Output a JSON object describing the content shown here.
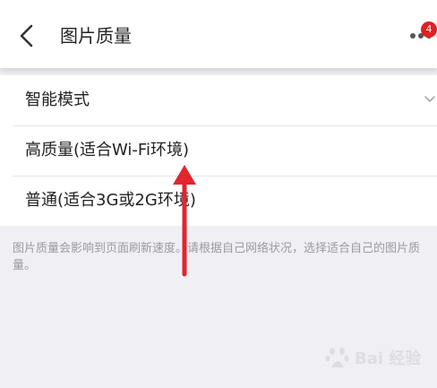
{
  "header": {
    "title": "图片质量",
    "badge_count": "4"
  },
  "options": [
    {
      "label": "智能模式"
    },
    {
      "label": "高质量(适合Wi-Fi环境)"
    },
    {
      "label": "普通(适合3G或2G环境)"
    }
  ],
  "hint": "图片质量会影响到页面刷新速度。请根据自己网络状况，选择适合自己的图片质量。",
  "colors": {
    "accent_arrow": "#e0262f",
    "badge": "#e02020",
    "background": "#f0eff4"
  },
  "icons": {
    "back": "chevron-left-icon",
    "more": "more-dots-icon",
    "dropdown": "chevron-down-icon",
    "annotation": "red-arrow-icon"
  },
  "watermark": {
    "text": "Bai 经验"
  }
}
